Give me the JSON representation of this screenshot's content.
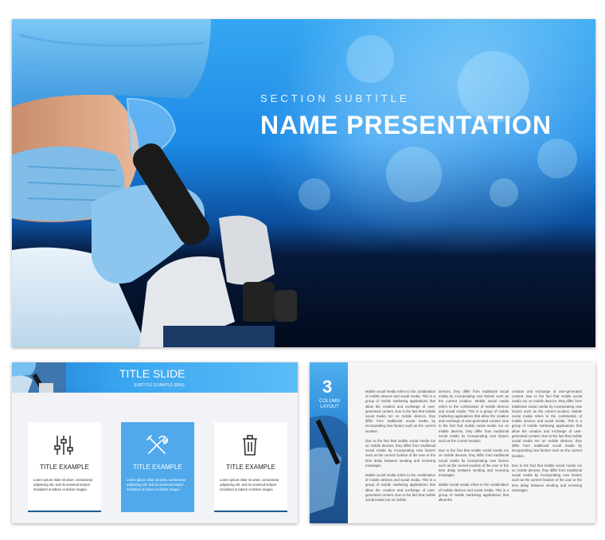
{
  "hero": {
    "section_subtitle": "SECTION SUBTITLE",
    "title": "NAME PRESENTATION"
  },
  "title_slide": {
    "title": "TITLE SLIDE",
    "subtitle": "SUBTITLE EXAMPLE (80%)",
    "cards": [
      {
        "icon": "sliders-icon",
        "title": "TITLE EXAMPLE",
        "text": "Lorem ipsum dolor sit amet, consectetur adipiscing elit, sed do eiusmod tempor incididunt ut labore et dolore magna"
      },
      {
        "icon": "tools-icon",
        "title": "TITLE EXAMPLE",
        "text": "Lorem ipsum dolor sit amet, consectetur adipiscing elit, sed do eiusmod tempor incididunt ut labore et dolore magna"
      },
      {
        "icon": "trash-icon",
        "title": "TITLE EXAMPLE",
        "text": "Lorem ipsum dolor sit amet, consectetur adipiscing elit, sed do eiusmod tempor incididunt ut labore et dolore magna"
      }
    ]
  },
  "column_slide": {
    "number": "3",
    "label": "COLUMN LAYOUT",
    "columns": [
      [
        "Mobile social media refers to the combination of mobile devices and social media. This is a group of mobile marketing applications that allow the creation and exchange of user-generated content. Due to the fact that mobile social media run on mobile devices, they differ from traditional social media by incorporating new factors such as the current location.",
        "Due to the fact that mobile social media run on mobile devices, they differ from traditional social media by incorporating new factors such as the current location of the user or the time delay between sending and receiving messages.",
        "Mobile social media refers to the combination of mobile devices and social media. This is a group of mobile marketing applications that allow the creation and exchange of user-generated content. Due to the fact that mobile social media run on mobile"
      ],
      [
        "devices, they differ from traditional social media by incorporating new factors such as the current location. Mobile social media refers to the combination of mobile devices and social media. This is a group of mobile marketing applications that allow the creation and exchange of user-generated content. Due to the fact that mobile social media run on mobile devices, they differ from traditional social media by incorporating new factors such as the current location.",
        "Due to the fact that mobile social media run on mobile devices, they differ from traditional social media by incorporating new factors such as the current location of the user or the time delay between sending and receiving messages.",
        "Mobile social media refers to the combination of mobile devices and social media. This is a group of mobile marketing applications that allow the"
      ],
      [
        "creation and exchange of user-generated content. Due to the fact that mobile social media run on mobile devices, they differ from traditional social media by incorporating new factors such as the current location. Mobile social media refers to the combination of mobile devices and social media. This is a group of mobile marketing applications that allow the creation and exchange of user-generated content. Due to the fact that mobile social media run on mobile devices, they differ from traditional social media by incorporating new factors such as the current location.",
        "Due to the fact that mobile social media run on mobile devices, they differ from traditional social media by incorporating new factors such as the current location of the user or the time delay between sending and receiving messages."
      ]
    ]
  }
}
